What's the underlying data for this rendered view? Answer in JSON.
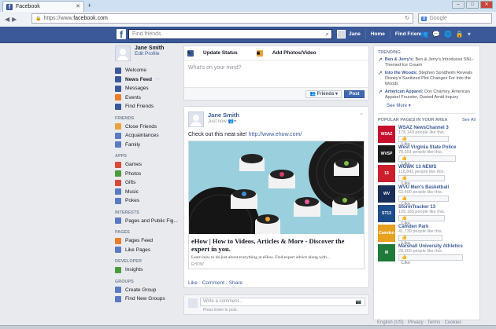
{
  "browser": {
    "tab_title": "Facebook",
    "url_prefix": "https://www.",
    "url_host": "facebook.com",
    "search_placeholder": "Google",
    "new_tab": "+"
  },
  "topbar": {
    "search_placeholder": "Find friends",
    "user": "Jane",
    "home": "Home",
    "find_friends": "Find Friends"
  },
  "sidebar": {
    "name": "Jane Smith",
    "edit_profile": "Edit Profile",
    "main": [
      {
        "label": "Welcome",
        "color": "#3b5998"
      },
      {
        "label": "News Feed",
        "color": "#3b5998",
        "bold": true
      },
      {
        "label": "Messages",
        "color": "#3b5998"
      },
      {
        "label": "Events",
        "color": "#e87d2b"
      },
      {
        "label": "Find Friends",
        "color": "#3b5998"
      }
    ],
    "friends_heading": "FRIENDS",
    "friends": [
      {
        "label": "Close Friends",
        "color": "#e8a23b"
      },
      {
        "label": "Acquaintances",
        "color": "#5b7bc0"
      },
      {
        "label": "Family",
        "color": "#5b7bc0"
      }
    ],
    "apps_heading": "APPS",
    "apps": [
      {
        "label": "Games",
        "color": "#d84a38"
      },
      {
        "label": "Photos",
        "color": "#4d9a3b"
      },
      {
        "label": "Gifts",
        "color": "#d84a38"
      },
      {
        "label": "Music",
        "color": "#5b7bc0"
      },
      {
        "label": "Pokes",
        "color": "#5b7bc0"
      }
    ],
    "interests_heading": "INTERESTS",
    "interests": [
      {
        "label": "Pages and Public Fig...",
        "color": "#5b7bc0"
      }
    ],
    "pages_heading": "PAGES",
    "pages": [
      {
        "label": "Pages Feed",
        "color": "#e87d2b"
      },
      {
        "label": "Like Pages",
        "color": "#5b7bc0"
      }
    ],
    "developer_heading": "DEVELOPER",
    "developer": [
      {
        "label": "Insights",
        "color": "#4d9a3b"
      }
    ],
    "groups_heading": "GROUPS",
    "groups": [
      {
        "label": "Create Group",
        "color": "#5b7bc0"
      },
      {
        "label": "Find New Groups",
        "color": "#5b7bc0"
      }
    ]
  },
  "composer": {
    "update_status": "Update Status",
    "add_photo": "Add Photos/Video",
    "placeholder": "What's on your mind?",
    "audience": "Friends",
    "post": "Post"
  },
  "post": {
    "author": "Jane Smith",
    "time": "Just now",
    "text": "Check out this neat site! ",
    "link": "http://www.ehow.com/",
    "link_title": "eHow | How to Videos, Articles & More - Discover the expert in you.",
    "link_desc": "Learn how to do just about everything at eHow. Find expert advice along with...",
    "link_source": "EHOW",
    "like": "Like",
    "comment": "Comment",
    "share": "Share",
    "comment_placeholder": "Write a comment...",
    "comment_hint": "Press Enter to post."
  },
  "trending": {
    "heading": "TRENDING",
    "items": [
      {
        "title": "Ben & Jerry's:",
        "text": " Ben & Jerry's Introduces SNL-Themed Ice Cream"
      },
      {
        "title": "Into the Woods:",
        "text": " Stephen Sondheim Reveals Disney's Sanitized Plot Changes For Into the Woods"
      },
      {
        "title": "American Apparel:",
        "text": " Dov Charney, American Apparel Founder, Ousted Amid Inquiry"
      }
    ],
    "see_more": "See More"
  },
  "popular": {
    "heading": "POPULAR PAGES IN YOUR AREA",
    "see_all": "See All",
    "like": "Like",
    "pages": [
      {
        "name": "WSAZ NewsChannel 3",
        "likes": "178,149 people like this.",
        "logo": "WSAZ",
        "color": "#c8102e"
      },
      {
        "name": "West Virginia State Police",
        "likes": "78,591 people like this.",
        "logo": "WVSP",
        "color": "#1b1b1b"
      },
      {
        "name": "WOWK 13 NEWS",
        "likes": "116,842 people like this.",
        "logo": "13",
        "color": "#cc1f2d"
      },
      {
        "name": "WVU Men's Basketball",
        "likes": "62,490 people like this.",
        "logo": "WV",
        "color": "#1a2e5a"
      },
      {
        "name": "StormTracker 13",
        "likes": "109,183 people like this.",
        "logo": "ST13",
        "color": "#1d4c8a"
      },
      {
        "name": "Camden Park",
        "likes": "41,739 people like this.",
        "logo": "Camden",
        "color": "#e8a020"
      },
      {
        "name": "Marshall University Athletics",
        "likes": "28,360 people like this.",
        "logo": "M",
        "color": "#1f7a3a"
      }
    ]
  },
  "footer": "English (US) · Privacy · Terms · Cookies"
}
